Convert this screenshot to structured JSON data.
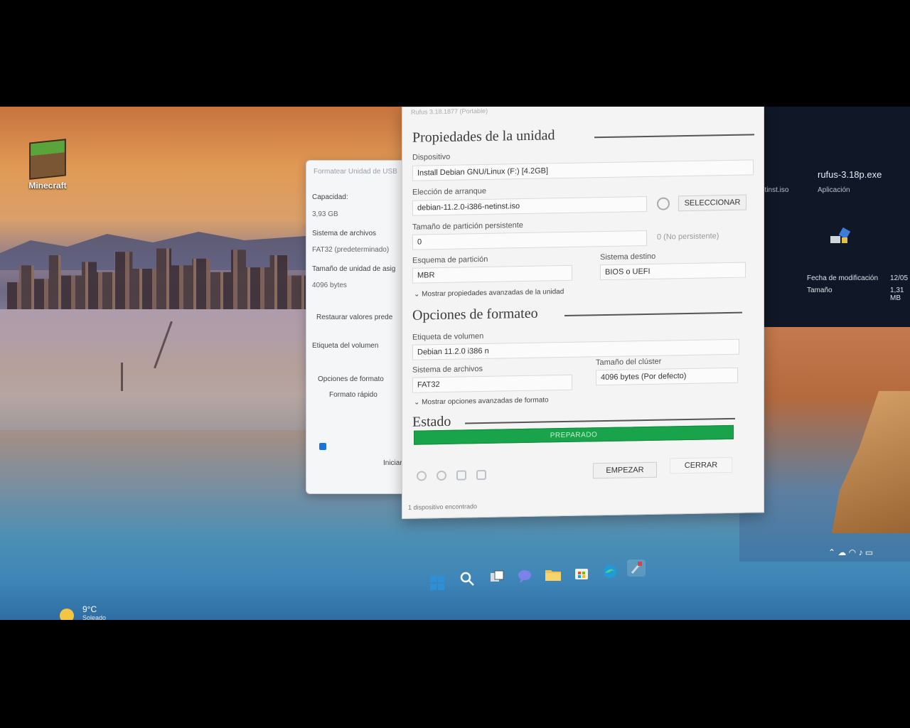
{
  "desktop": {
    "icon_minecraft": "Minecraft",
    "file_partial": "etinst.iso",
    "rufus_file": "rufus-3.18p.exe",
    "rufus_type": "Aplicación",
    "fecha_label": "Fecha de modificación",
    "fecha_value": "12/05",
    "tamano_label": "Tamaño",
    "tamano_value": "1,31 MB"
  },
  "props_window": {
    "title": "Formatear Unidad de USB",
    "capacidad_label": "Capacidad:",
    "capacidad_value": "3,93 GB",
    "sistema_label": "Sistema de archivos",
    "sistema_value": "FAT32 (predeterminado)",
    "tamano_label": "Tamaño de unidad de asig",
    "tamano_value": "4096 bytes",
    "restaurar_label": "Restaurar valores prede",
    "etiqueta_label": "Etiqueta del volumen",
    "opciones_label": "Opciones de formato",
    "formato_rapido": "Formato rápido",
    "iniciar": "Iniciar"
  },
  "rufus": {
    "title": "Rufus 3.18.1877 (Portable)",
    "section_drive": "Propiedades de la unidad",
    "dispositivo_label": "Dispositivo",
    "dispositivo_value": "Install Debian GNU/Linux (F:) [4.2GB]",
    "eleccion_label": "Elección de arranque",
    "eleccion_value": "debian-11.2.0-i386-netinst.iso",
    "seleccionar_button": "SELECCIONAR",
    "persist_label": "Tamaño de partición persistente",
    "persist_value": "0",
    "persist_note": "0 (No persistente)",
    "esquema_label": "Esquema de partición",
    "esquema_value": "MBR",
    "destino_label": "Sistema destino",
    "destino_value": "BIOS o UEFI",
    "advanced_drive": "Mostrar propiedades avanzadas de la unidad",
    "section_format": "Opciones de formateo",
    "etiqueta_label": "Etiqueta de volumen",
    "etiqueta_value": "Debian 11.2.0 i386 n",
    "fs_label": "Sistema de archivos",
    "fs_value": "FAT32",
    "cluster_label": "Tamaño del clúster",
    "cluster_value": "4096 bytes (Por defecto)",
    "advanced_format": "Mostrar opciones avanzadas de formato",
    "section_status": "Estado",
    "progress_text": "PREPARADO",
    "progress_fraction": 1.0,
    "empezar_button": "EMPEZAR",
    "cerrar_button": "CERRAR",
    "status_bar": "1 dispositivo encontrado"
  },
  "taskbar": {
    "weather_temp": "9°C",
    "weather_desc": "Soleado",
    "icons": [
      "windows-start-icon",
      "search-icon",
      "task-view-icon",
      "chat-icon",
      "file-explorer-icon",
      "store-icon",
      "edge-icon",
      "rufus-icon"
    ]
  },
  "colors": {
    "progress": "#19a34a",
    "window_bg": "#f4f4f4",
    "taskbar_accent": "#2d8fd8"
  }
}
